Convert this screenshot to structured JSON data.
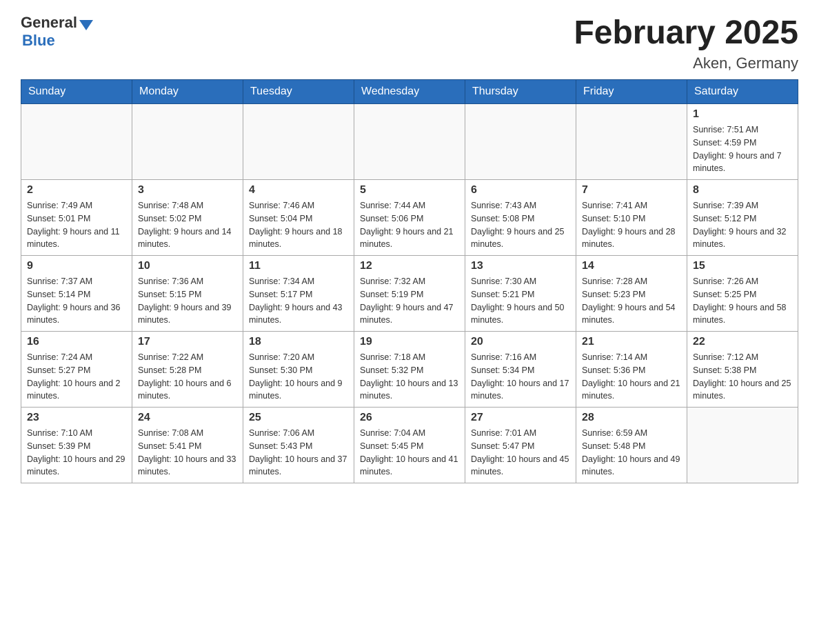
{
  "header": {
    "logo_general": "General",
    "logo_blue": "Blue",
    "title": "February 2025",
    "subtitle": "Aken, Germany"
  },
  "calendar": {
    "days": [
      "Sunday",
      "Monday",
      "Tuesday",
      "Wednesday",
      "Thursday",
      "Friday",
      "Saturday"
    ],
    "weeks": [
      [
        {
          "day": "",
          "info": ""
        },
        {
          "day": "",
          "info": ""
        },
        {
          "day": "",
          "info": ""
        },
        {
          "day": "",
          "info": ""
        },
        {
          "day": "",
          "info": ""
        },
        {
          "day": "",
          "info": ""
        },
        {
          "day": "1",
          "info": "Sunrise: 7:51 AM\nSunset: 4:59 PM\nDaylight: 9 hours and 7 minutes."
        }
      ],
      [
        {
          "day": "2",
          "info": "Sunrise: 7:49 AM\nSunset: 5:01 PM\nDaylight: 9 hours and 11 minutes."
        },
        {
          "day": "3",
          "info": "Sunrise: 7:48 AM\nSunset: 5:02 PM\nDaylight: 9 hours and 14 minutes."
        },
        {
          "day": "4",
          "info": "Sunrise: 7:46 AM\nSunset: 5:04 PM\nDaylight: 9 hours and 18 minutes."
        },
        {
          "day": "5",
          "info": "Sunrise: 7:44 AM\nSunset: 5:06 PM\nDaylight: 9 hours and 21 minutes."
        },
        {
          "day": "6",
          "info": "Sunrise: 7:43 AM\nSunset: 5:08 PM\nDaylight: 9 hours and 25 minutes."
        },
        {
          "day": "7",
          "info": "Sunrise: 7:41 AM\nSunset: 5:10 PM\nDaylight: 9 hours and 28 minutes."
        },
        {
          "day": "8",
          "info": "Sunrise: 7:39 AM\nSunset: 5:12 PM\nDaylight: 9 hours and 32 minutes."
        }
      ],
      [
        {
          "day": "9",
          "info": "Sunrise: 7:37 AM\nSunset: 5:14 PM\nDaylight: 9 hours and 36 minutes."
        },
        {
          "day": "10",
          "info": "Sunrise: 7:36 AM\nSunset: 5:15 PM\nDaylight: 9 hours and 39 minutes."
        },
        {
          "day": "11",
          "info": "Sunrise: 7:34 AM\nSunset: 5:17 PM\nDaylight: 9 hours and 43 minutes."
        },
        {
          "day": "12",
          "info": "Sunrise: 7:32 AM\nSunset: 5:19 PM\nDaylight: 9 hours and 47 minutes."
        },
        {
          "day": "13",
          "info": "Sunrise: 7:30 AM\nSunset: 5:21 PM\nDaylight: 9 hours and 50 minutes."
        },
        {
          "day": "14",
          "info": "Sunrise: 7:28 AM\nSunset: 5:23 PM\nDaylight: 9 hours and 54 minutes."
        },
        {
          "day": "15",
          "info": "Sunrise: 7:26 AM\nSunset: 5:25 PM\nDaylight: 9 hours and 58 minutes."
        }
      ],
      [
        {
          "day": "16",
          "info": "Sunrise: 7:24 AM\nSunset: 5:27 PM\nDaylight: 10 hours and 2 minutes."
        },
        {
          "day": "17",
          "info": "Sunrise: 7:22 AM\nSunset: 5:28 PM\nDaylight: 10 hours and 6 minutes."
        },
        {
          "day": "18",
          "info": "Sunrise: 7:20 AM\nSunset: 5:30 PM\nDaylight: 10 hours and 9 minutes."
        },
        {
          "day": "19",
          "info": "Sunrise: 7:18 AM\nSunset: 5:32 PM\nDaylight: 10 hours and 13 minutes."
        },
        {
          "day": "20",
          "info": "Sunrise: 7:16 AM\nSunset: 5:34 PM\nDaylight: 10 hours and 17 minutes."
        },
        {
          "day": "21",
          "info": "Sunrise: 7:14 AM\nSunset: 5:36 PM\nDaylight: 10 hours and 21 minutes."
        },
        {
          "day": "22",
          "info": "Sunrise: 7:12 AM\nSunset: 5:38 PM\nDaylight: 10 hours and 25 minutes."
        }
      ],
      [
        {
          "day": "23",
          "info": "Sunrise: 7:10 AM\nSunset: 5:39 PM\nDaylight: 10 hours and 29 minutes."
        },
        {
          "day": "24",
          "info": "Sunrise: 7:08 AM\nSunset: 5:41 PM\nDaylight: 10 hours and 33 minutes."
        },
        {
          "day": "25",
          "info": "Sunrise: 7:06 AM\nSunset: 5:43 PM\nDaylight: 10 hours and 37 minutes."
        },
        {
          "day": "26",
          "info": "Sunrise: 7:04 AM\nSunset: 5:45 PM\nDaylight: 10 hours and 41 minutes."
        },
        {
          "day": "27",
          "info": "Sunrise: 7:01 AM\nSunset: 5:47 PM\nDaylight: 10 hours and 45 minutes."
        },
        {
          "day": "28",
          "info": "Sunrise: 6:59 AM\nSunset: 5:48 PM\nDaylight: 10 hours and 49 minutes."
        },
        {
          "day": "",
          "info": ""
        }
      ]
    ]
  }
}
